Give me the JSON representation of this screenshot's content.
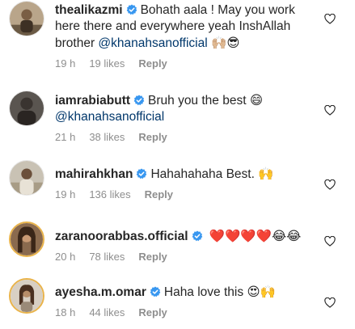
{
  "comments": [
    {
      "username": "thealikazmi",
      "text": "Bohath aala ! May you work",
      "text2": "here there and everywhere yeah InshAllah",
      "text3_prefix": "brother ",
      "mention": "@khanahsanofficial",
      "emoji": "🙌🏼😎",
      "time": "19 h",
      "likes": "19 likes",
      "reply": "Reply"
    },
    {
      "username": "iamrabiabutt",
      "text": "Bruh you the best",
      "emoji": "😄",
      "mention": "@khanahsanofficial",
      "time": "21 h",
      "likes": "38 likes",
      "reply": "Reply"
    },
    {
      "username": "mahirahkhan",
      "text": "Hahahahaha Best.",
      "emoji": "🙌",
      "time": "19 h",
      "likes": "136 likes",
      "reply": "Reply"
    },
    {
      "username": "zaranoorabbas.official",
      "emoji": "❤️❤️❤️❤️😂😂",
      "time": "20 h",
      "likes": "78 likes",
      "reply": "Reply"
    },
    {
      "username": "ayesha.m.omar",
      "text": "Haha love this",
      "emoji": "😍🙌",
      "time": "18 h",
      "likes": "44 likes",
      "reply": "Reply"
    }
  ],
  "colors": {
    "verified": "#3897f0",
    "mention": "#00376b",
    "meta": "#8e8e8e"
  },
  "icons": {
    "verified": "verified-badge-icon",
    "like": "heart-outline-icon"
  }
}
